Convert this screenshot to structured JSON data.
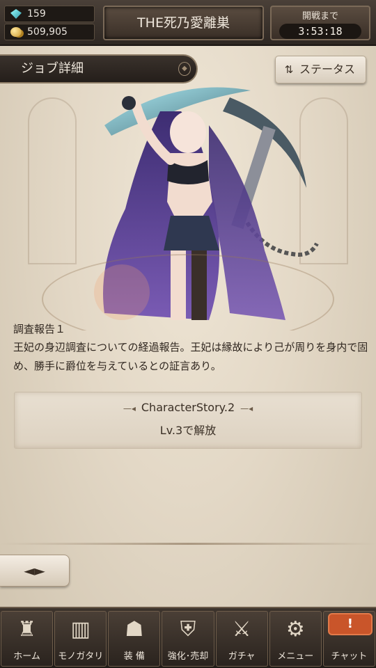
{
  "header": {
    "gems": "159",
    "gold": "509,905",
    "title": "THE死乃愛離巣",
    "battle_label": "開戦まで",
    "battle_timer": "3:53:18"
  },
  "job": {
    "header_label": "ジョブ詳細",
    "status_button": "ステータス"
  },
  "description": {
    "title": "調査報告１",
    "body": "王妃の身辺調査についての経過報告。王妃は縁故により己が周りを身内で固め、勝手に爵位を与えているとの証言あり。"
  },
  "story": {
    "title": "CharacterStory.2",
    "unlock": "Lv.3で解放"
  },
  "nav": {
    "items": [
      {
        "label": "ホーム",
        "icon": "castle-icon"
      },
      {
        "label": "モノガタリ",
        "icon": "book-icon"
      },
      {
        "label": "装 備",
        "icon": "equipment-icon"
      },
      {
        "label": "強化･売却",
        "icon": "enhance-icon"
      },
      {
        "label": "ガチャ",
        "icon": "gacha-swords-icon"
      },
      {
        "label": "メニュー",
        "icon": "gears-icon"
      },
      {
        "label": "チャット",
        "icon": "chat-icon",
        "badge": "!"
      }
    ]
  },
  "colors": {
    "chat_badge": "#c9552a",
    "nav_bg": "#2a231e",
    "parchment": "#e3d8c6"
  }
}
